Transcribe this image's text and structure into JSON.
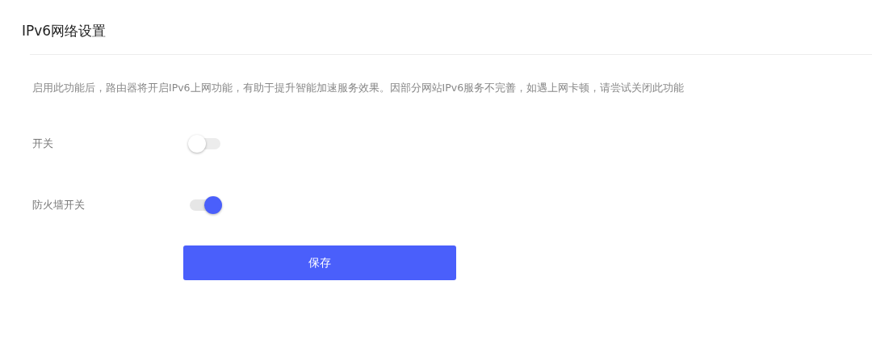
{
  "title": "IPv6网络设置",
  "description": "启用此功能后，路由器将开启IPv6上网功能，有助于提升智能加速服务效果。因部分网站IPv6服务不完善，如遇上网卡顿，请尝试关闭此功能",
  "settings": [
    {
      "label": "开关",
      "on": false
    },
    {
      "label": "防火墙开关",
      "on": true
    }
  ],
  "save_button": "保存"
}
